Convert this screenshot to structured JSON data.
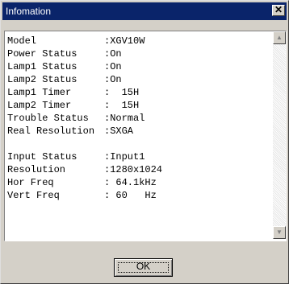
{
  "window": {
    "title": "Infomation",
    "close_glyph": "✕"
  },
  "info": [
    {
      "label": "Model",
      "value": ":XGV10W"
    },
    {
      "label": "Power Status",
      "value": ":On"
    },
    {
      "label": "Lamp1 Status",
      "value": ":On"
    },
    {
      "label": "Lamp2 Status",
      "value": ":On"
    },
    {
      "label": "Lamp1 Timer",
      "value": ":  15H"
    },
    {
      "label": "Lamp2 Timer",
      "value": ":  15H"
    },
    {
      "label": "Trouble Status",
      "value": ":Normal"
    },
    {
      "label": "Real Resolution",
      "value": ":SXGA"
    },
    {
      "label": "Input Status",
      "value": ":Input1"
    },
    {
      "label": "Resolution",
      "value": ":1280x1024"
    },
    {
      "label": "Hor Freq",
      "value": ": 64.1kHz"
    },
    {
      "label": "Vert Freq",
      "value": ": 60   Hz"
    }
  ],
  "scrollbar": {
    "up_glyph": "▲",
    "down_glyph": "▼"
  },
  "buttons": {
    "ok_label": "OK"
  }
}
